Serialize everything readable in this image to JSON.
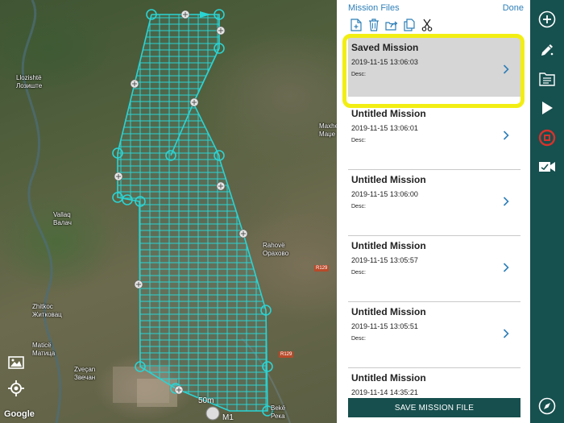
{
  "map": {
    "labels": [
      {
        "text": "Llozishtë\nЛозиште"
      },
      {
        "text": "Vallaq\nВалач"
      },
      {
        "text": "Zhitkoc\nЖитковац"
      },
      {
        "text": "Maticë\nМатица"
      },
      {
        "text": "Zveçan\nЗвечан"
      },
      {
        "text": "Rahovë\nОраховo"
      },
      {
        "text": "Maxhe\nМаџе"
      },
      {
        "text": "Bekë\nРека"
      }
    ],
    "road_badges": [
      "R129",
      "R129"
    ],
    "scale_text": "50m",
    "home_label": "M1",
    "attribution": "Google"
  },
  "panel": {
    "title": "Mission Files",
    "done_label": "Done",
    "toolbar_icons": [
      "new-file-icon",
      "trash-icon",
      "share-icon",
      "duplicate-icon",
      "cut-icon"
    ],
    "missions": [
      {
        "title": "Saved Mission",
        "date": "2019-11-15 13:06:03",
        "desc": "Desc:"
      },
      {
        "title": "Untitled Mission",
        "date": "2019-11-15 13:06:01",
        "desc": "Desc:"
      },
      {
        "title": "Untitled Mission",
        "date": "2019-11-15 13:06:00",
        "desc": "Desc:"
      },
      {
        "title": "Untitled Mission",
        "date": "2019-11-15 13:05:57",
        "desc": "Desc:"
      },
      {
        "title": "Untitled Mission",
        "date": "2019-11-15 13:05:51",
        "desc": "Desc:"
      },
      {
        "title": "Untitled Mission",
        "date": "2019-11-14 14:35:21",
        "desc": ""
      }
    ],
    "save_label": "SAVE MISSION FILE"
  },
  "rail": {
    "buttons": [
      "add-icon",
      "edit-pencil-icon",
      "mission-files-icon",
      "play-icon",
      "record-icon",
      "video-camera-icon",
      "compass-icon"
    ]
  },
  "colors": {
    "accent": "#2e7fb8",
    "rail_bg": "#16504f",
    "survey_line": "#2bd3d3",
    "highlight": "#f2ee14",
    "selected_card": "#d6d6d6"
  }
}
